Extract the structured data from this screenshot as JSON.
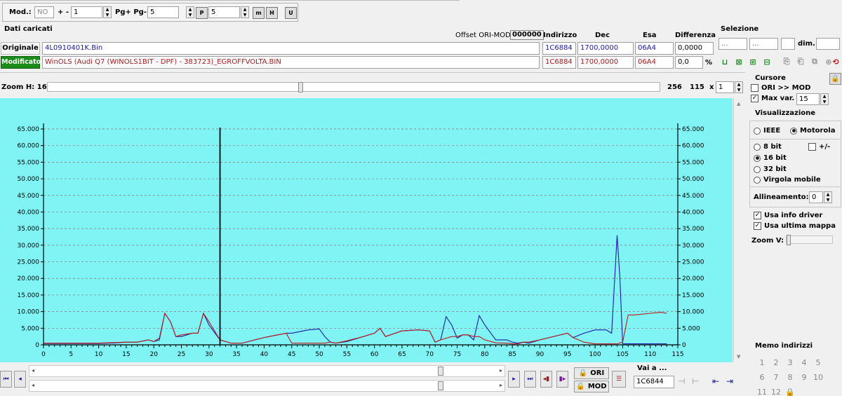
{
  "toolbar": {
    "mod_label": "Mod.:",
    "mod_value": "NO",
    "plusminus_label": "+ -",
    "plusminus_value": "1",
    "pg_label": "Pg+ Pg-",
    "pg_value": "5",
    "p_value": "5"
  },
  "data_loaded": {
    "title": "Dati caricati",
    "offset_label": "Offset ORI-MOD",
    "offset_value": "000000",
    "headers": {
      "indirizzo": "Indirizzo",
      "dec": "Dec",
      "esa": "Esa",
      "differenza": "Differenza"
    },
    "original": {
      "label": "Originale",
      "file": "4L0910401K.Bin",
      "address": "1C6884",
      "dec": "1700,0000",
      "esa": "06A4",
      "diff": "0,0000"
    },
    "modified": {
      "label": "Modificato",
      "file": "WinOLS (Audi Q7 (WINOLS1BIT - DPF) - 383723)_EGROFFVOLTA.BIN",
      "address": "1C6884",
      "dec": "1700,0000",
      "esa": "06A4",
      "diff": "0,0",
      "percent": "%"
    }
  },
  "selection": {
    "title": "Selezione",
    "field1": "...",
    "field2": "...",
    "dim_label": "dim."
  },
  "zoom": {
    "label": "Zoom H: 16",
    "max": "256",
    "value": "115",
    "x_label": "x",
    "mult": "1"
  },
  "cursor": {
    "title": "Cursore",
    "ori_mod": "ORI >> MOD",
    "max_var_label": "Max var.",
    "max_var_value": "15"
  },
  "visual": {
    "title": "Visualizzazione",
    "ieee": "IEEE",
    "motorola": "Motorola",
    "bit8": "8 bit",
    "plusminus": "+/-",
    "bit16": "16 bit",
    "bit32": "32 bit",
    "float": "Virgola mobile",
    "align_label": "Allineamento:",
    "align_value": "0",
    "driver_info": "Usa info driver",
    "last_map": "Usa ultima mappa",
    "zoom_v": "Zoom V:"
  },
  "memo": {
    "title": "Memo indirizzi",
    "items": [
      "1",
      "2",
      "3",
      "4",
      "5",
      "6",
      "7",
      "8",
      "9",
      "10",
      "11",
      "12"
    ]
  },
  "bottom": {
    "ori_btn": "ORI",
    "mod_btn": "MOD",
    "goto_label": "Vai a ...",
    "goto_value": "1C6844"
  },
  "colors": {
    "plot_bg": "#80f4f4",
    "original": "#c01818",
    "modified": "#1a1aa8",
    "cursor": "#000000"
  },
  "chart_data": {
    "type": "line",
    "xlim": [
      0,
      115
    ],
    "ylim": [
      0,
      65000
    ],
    "x_ticks": [
      0,
      5,
      10,
      15,
      20,
      25,
      30,
      35,
      40,
      45,
      50,
      55,
      60,
      65,
      70,
      75,
      80,
      85,
      90,
      95,
      100,
      105,
      110,
      115
    ],
    "y_ticks": [
      "0",
      "5.000",
      "10.000",
      "15.000",
      "20.000",
      "25.000",
      "30.000",
      "35.000",
      "40.000",
      "45.000",
      "50.000",
      "55.000",
      "60.000",
      "65.000"
    ],
    "cursor_x": 32,
    "series": [
      {
        "color": "#1a1aa8",
        "x": [
          0,
          10,
          13,
          15,
          17,
          19,
          20,
          21,
          22,
          23,
          24,
          25,
          27,
          28,
          29,
          30,
          32,
          34,
          36,
          40,
          44,
          45,
          48,
          50,
          51,
          52,
          53,
          55,
          58,
          60,
          61,
          62,
          65,
          68,
          70,
          71,
          72,
          73,
          74,
          75,
          76,
          77,
          78,
          79,
          80,
          82,
          84,
          85,
          86,
          87,
          88,
          90,
          95,
          96,
          98,
          100,
          102,
          103,
          104,
          104.5,
          105,
          106,
          107,
          110,
          112,
          113
        ],
        "y": [
          400,
          400,
          600,
          800,
          800,
          1500,
          1000,
          1500,
          9500,
          7000,
          2500,
          2500,
          3500,
          3500,
          9500,
          6000,
          1500,
          500,
          500,
          2200,
          3500,
          3500,
          4500,
          4800,
          2500,
          800,
          500,
          1000,
          2500,
          3500,
          5000,
          2500,
          4200,
          4500,
          4200,
          800,
          1500,
          8500,
          6000,
          2000,
          3000,
          3000,
          1500,
          8800,
          6000,
          1500,
          1500,
          800,
          500,
          800,
          500,
          1500,
          3500,
          2200,
          3500,
          4500,
          4500,
          3500,
          33000,
          20000,
          300,
          300,
          300,
          300,
          300,
          300
        ]
      },
      {
        "color": "#c01818",
        "x": [
          0,
          10,
          13,
          15,
          17,
          19,
          20,
          21,
          22,
          23,
          24,
          25,
          27,
          28,
          29,
          30,
          32,
          34,
          36,
          40,
          44,
          45,
          48,
          50,
          51,
          52,
          53,
          55,
          58,
          60,
          61,
          62,
          65,
          68,
          70,
          71,
          72,
          73,
          74,
          75,
          76,
          77,
          78,
          79,
          80,
          82,
          84,
          85,
          86,
          87,
          88,
          90,
          95,
          96,
          98,
          100,
          102,
          103,
          104,
          105,
          106,
          107,
          110,
          112,
          113
        ],
        "y": [
          500,
          500,
          700,
          800,
          800,
          1500,
          1000,
          2000,
          9500,
          7000,
          2500,
          3000,
          3500,
          3500,
          9500,
          7000,
          1500,
          500,
          500,
          2200,
          3500,
          500,
          500,
          500,
          500,
          800,
          500,
          1200,
          2500,
          3500,
          5000,
          2500,
          4200,
          4500,
          4200,
          800,
          1500,
          2000,
          2500,
          2500,
          3000,
          3000,
          2500,
          2500,
          1500,
          600,
          500,
          300,
          300,
          800,
          800,
          1500,
          3500,
          2200,
          800,
          300,
          300,
          300,
          300,
          800,
          9000,
          9000,
          9500,
          9800,
          9500
        ]
      }
    ]
  }
}
